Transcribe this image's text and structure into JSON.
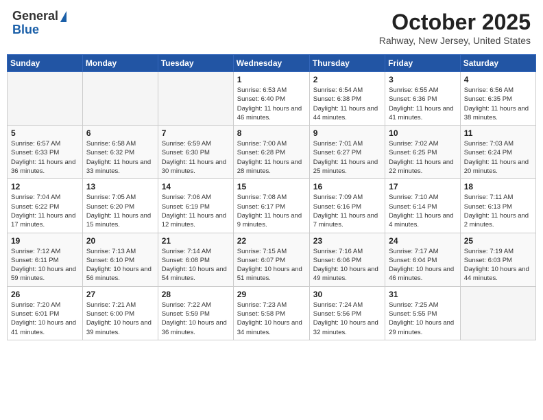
{
  "header": {
    "logo_general": "General",
    "logo_blue": "Blue",
    "title": "October 2025",
    "subtitle": "Rahway, New Jersey, United States"
  },
  "days_of_week": [
    "Sunday",
    "Monday",
    "Tuesday",
    "Wednesday",
    "Thursday",
    "Friday",
    "Saturday"
  ],
  "weeks": [
    [
      {
        "day": "",
        "info": ""
      },
      {
        "day": "",
        "info": ""
      },
      {
        "day": "",
        "info": ""
      },
      {
        "day": "1",
        "info": "Sunrise: 6:53 AM\nSunset: 6:40 PM\nDaylight: 11 hours and 46 minutes."
      },
      {
        "day": "2",
        "info": "Sunrise: 6:54 AM\nSunset: 6:38 PM\nDaylight: 11 hours and 44 minutes."
      },
      {
        "day": "3",
        "info": "Sunrise: 6:55 AM\nSunset: 6:36 PM\nDaylight: 11 hours and 41 minutes."
      },
      {
        "day": "4",
        "info": "Sunrise: 6:56 AM\nSunset: 6:35 PM\nDaylight: 11 hours and 38 minutes."
      }
    ],
    [
      {
        "day": "5",
        "info": "Sunrise: 6:57 AM\nSunset: 6:33 PM\nDaylight: 11 hours and 36 minutes."
      },
      {
        "day": "6",
        "info": "Sunrise: 6:58 AM\nSunset: 6:32 PM\nDaylight: 11 hours and 33 minutes."
      },
      {
        "day": "7",
        "info": "Sunrise: 6:59 AM\nSunset: 6:30 PM\nDaylight: 11 hours and 30 minutes."
      },
      {
        "day": "8",
        "info": "Sunrise: 7:00 AM\nSunset: 6:28 PM\nDaylight: 11 hours and 28 minutes."
      },
      {
        "day": "9",
        "info": "Sunrise: 7:01 AM\nSunset: 6:27 PM\nDaylight: 11 hours and 25 minutes."
      },
      {
        "day": "10",
        "info": "Sunrise: 7:02 AM\nSunset: 6:25 PM\nDaylight: 11 hours and 22 minutes."
      },
      {
        "day": "11",
        "info": "Sunrise: 7:03 AM\nSunset: 6:24 PM\nDaylight: 11 hours and 20 minutes."
      }
    ],
    [
      {
        "day": "12",
        "info": "Sunrise: 7:04 AM\nSunset: 6:22 PM\nDaylight: 11 hours and 17 minutes."
      },
      {
        "day": "13",
        "info": "Sunrise: 7:05 AM\nSunset: 6:20 PM\nDaylight: 11 hours and 15 minutes."
      },
      {
        "day": "14",
        "info": "Sunrise: 7:06 AM\nSunset: 6:19 PM\nDaylight: 11 hours and 12 minutes."
      },
      {
        "day": "15",
        "info": "Sunrise: 7:08 AM\nSunset: 6:17 PM\nDaylight: 11 hours and 9 minutes."
      },
      {
        "day": "16",
        "info": "Sunrise: 7:09 AM\nSunset: 6:16 PM\nDaylight: 11 hours and 7 minutes."
      },
      {
        "day": "17",
        "info": "Sunrise: 7:10 AM\nSunset: 6:14 PM\nDaylight: 11 hours and 4 minutes."
      },
      {
        "day": "18",
        "info": "Sunrise: 7:11 AM\nSunset: 6:13 PM\nDaylight: 11 hours and 2 minutes."
      }
    ],
    [
      {
        "day": "19",
        "info": "Sunrise: 7:12 AM\nSunset: 6:11 PM\nDaylight: 10 hours and 59 minutes."
      },
      {
        "day": "20",
        "info": "Sunrise: 7:13 AM\nSunset: 6:10 PM\nDaylight: 10 hours and 56 minutes."
      },
      {
        "day": "21",
        "info": "Sunrise: 7:14 AM\nSunset: 6:08 PM\nDaylight: 10 hours and 54 minutes."
      },
      {
        "day": "22",
        "info": "Sunrise: 7:15 AM\nSunset: 6:07 PM\nDaylight: 10 hours and 51 minutes."
      },
      {
        "day": "23",
        "info": "Sunrise: 7:16 AM\nSunset: 6:06 PM\nDaylight: 10 hours and 49 minutes."
      },
      {
        "day": "24",
        "info": "Sunrise: 7:17 AM\nSunset: 6:04 PM\nDaylight: 10 hours and 46 minutes."
      },
      {
        "day": "25",
        "info": "Sunrise: 7:19 AM\nSunset: 6:03 PM\nDaylight: 10 hours and 44 minutes."
      }
    ],
    [
      {
        "day": "26",
        "info": "Sunrise: 7:20 AM\nSunset: 6:01 PM\nDaylight: 10 hours and 41 minutes."
      },
      {
        "day": "27",
        "info": "Sunrise: 7:21 AM\nSunset: 6:00 PM\nDaylight: 10 hours and 39 minutes."
      },
      {
        "day": "28",
        "info": "Sunrise: 7:22 AM\nSunset: 5:59 PM\nDaylight: 10 hours and 36 minutes."
      },
      {
        "day": "29",
        "info": "Sunrise: 7:23 AM\nSunset: 5:58 PM\nDaylight: 10 hours and 34 minutes."
      },
      {
        "day": "30",
        "info": "Sunrise: 7:24 AM\nSunset: 5:56 PM\nDaylight: 10 hours and 32 minutes."
      },
      {
        "day": "31",
        "info": "Sunrise: 7:25 AM\nSunset: 5:55 PM\nDaylight: 10 hours and 29 minutes."
      },
      {
        "day": "",
        "info": ""
      }
    ]
  ]
}
